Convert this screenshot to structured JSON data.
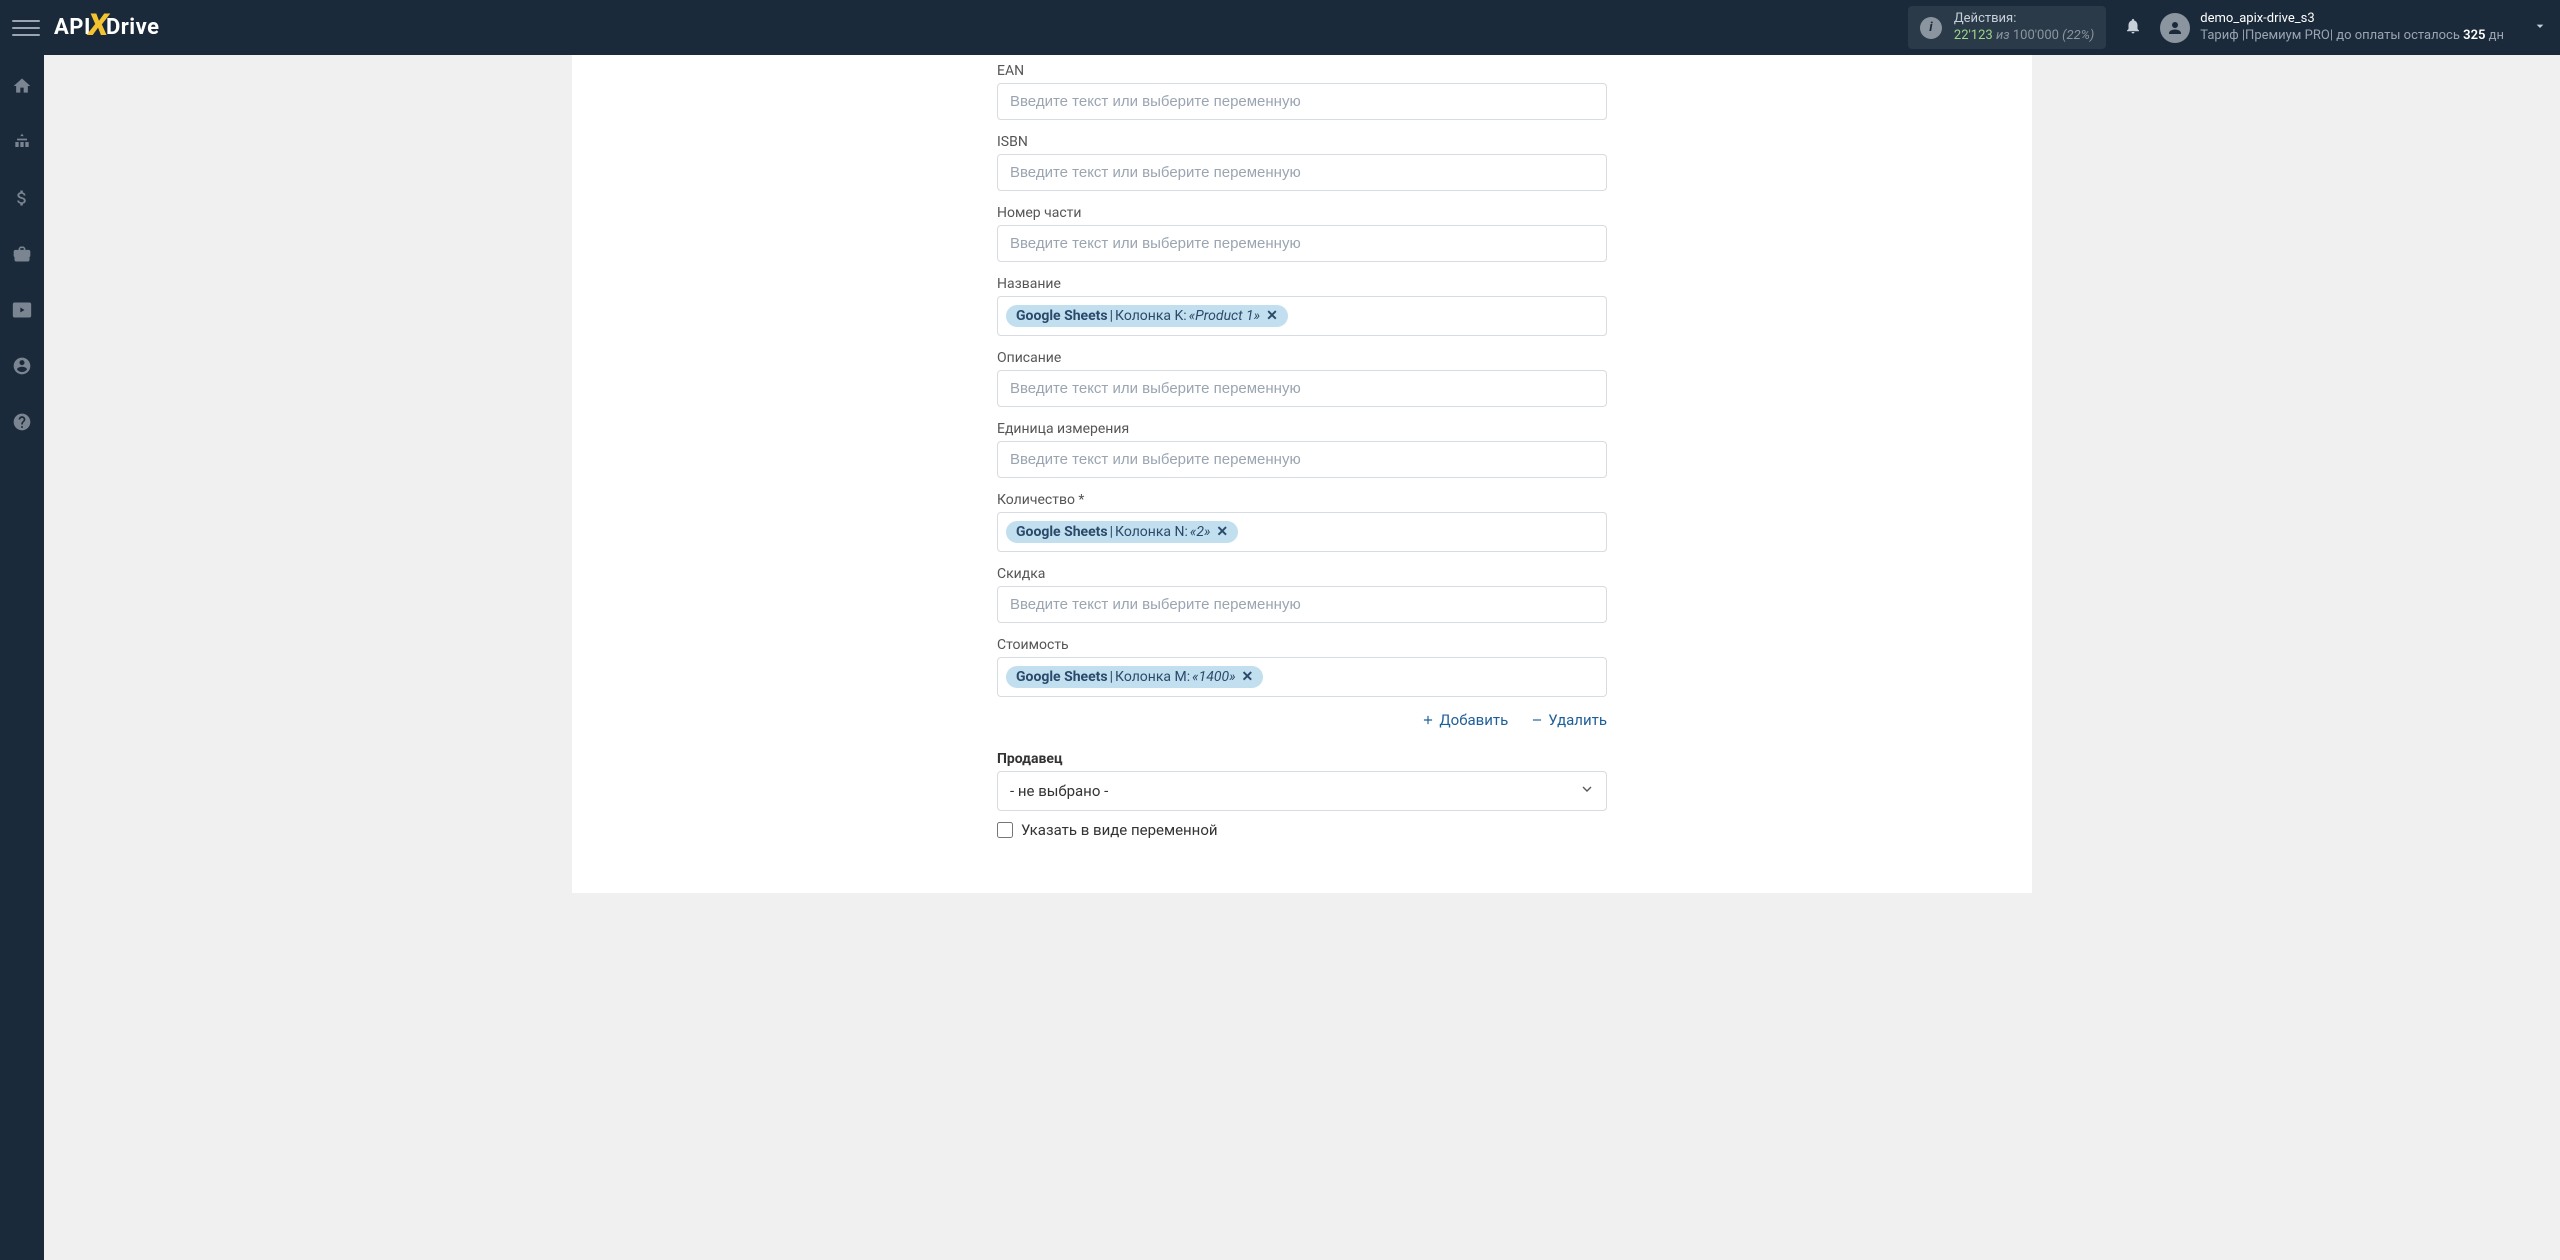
{
  "header": {
    "logo_text_1": "API",
    "logo_x": "X",
    "logo_text_2": "Drive",
    "actions": {
      "label": "Действия:",
      "count": "22'123",
      "sep": "из",
      "total": "100'000",
      "pct": "(22%)"
    },
    "user": {
      "name": "demo_apix-drive_s3",
      "tariff_pre": "Тариф |Премиум PRO| до оплаты осталось ",
      "days": "325",
      "tariff_suf": " дн"
    }
  },
  "form": {
    "fields": {
      "ean": {
        "label": "EAN",
        "placeholder": "Введите текст или выберите переменную"
      },
      "isbn": {
        "label": "ISBN",
        "placeholder": "Введите текст или выберите переменную"
      },
      "partnum": {
        "label": "Номер части",
        "placeholder": "Введите текст или выберите переменную"
      },
      "name": {
        "label": "Название",
        "tag": {
          "src": "Google Sheets",
          "sep": " | ",
          "col": "Колонка K: ",
          "val": "«Product 1»"
        }
      },
      "desc": {
        "label": "Описание",
        "placeholder": "Введите текст или выберите переменную"
      },
      "unit": {
        "label": "Единица измерения",
        "placeholder": "Введите текст или выберите переменную"
      },
      "qty": {
        "label": "Количество *",
        "tag": {
          "src": "Google Sheets",
          "sep": " | ",
          "col": "Колонка N: ",
          "val": "«2»"
        }
      },
      "discount": {
        "label": "Скидка",
        "placeholder": "Введите текст или выберите переменную"
      },
      "cost": {
        "label": "Стоимость",
        "tag": {
          "src": "Google Sheets",
          "sep": " | ",
          "col": "Колонка M: ",
          "val": "«1400»"
        }
      }
    },
    "actions": {
      "add": "Добавить",
      "delete": "Удалить"
    },
    "seller": {
      "label": "Продавец",
      "value": "- не выбрано -",
      "checkbox_label": "Указать в виде переменной"
    }
  }
}
